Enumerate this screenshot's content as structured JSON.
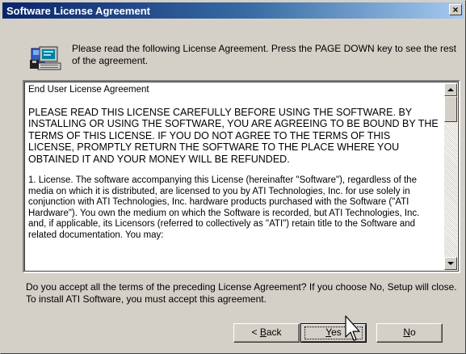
{
  "window": {
    "title": "Software License Agreement",
    "close_glyph": "×"
  },
  "header": {
    "icon": "setup-computer-icon",
    "instructions": "Please read the following License Agreement.  Press the PAGE DOWN key to see the rest of the agreement."
  },
  "license": {
    "heading": "End User License Agreement",
    "warning": "PLEASE READ THIS LICENSE CAREFULLY BEFORE USING THE SOFTWARE.  BY INSTALLING OR USING THE SOFTWARE, YOU ARE AGREEING TO BE BOUND BY THE TERMS OF THIS LICENSE.  IF YOU DO NOT AGREE TO THE TERMS OF THIS LICENSE, PROMPTLY RETURN THE SOFTWARE TO THE PLACE WHERE YOU OBTAINED IT AND YOUR MONEY WILL BE REFUNDED.",
    "clause1": "1. License.  The software accompanying this License (hereinafter \"Software\"), regardless of the media on which it is distributed, are licensed to you by ATI Technologies, Inc. for use solely in conjunction with ATI Technologies, Inc. hardware products purchased with the Software (\"ATI Hardware\").  You own the medium on which the Software is recorded, but ATI Technologies, Inc. and, if applicable, its Licensors (referred to collectively as \"ATI\") retain title to the Software and related documentation.  You may:"
  },
  "question": "Do you accept all the terms of the preceding License Agreement?  If you choose No,  Setup will close.  To install ATI Software, you must accept this agreement.",
  "buttons": {
    "back": {
      "before": "< ",
      "mnemonic": "B",
      "after": "ack"
    },
    "yes": {
      "mnemonic": "Y",
      "after": "es"
    },
    "no": {
      "mnemonic": "N",
      "after": "o"
    }
  }
}
